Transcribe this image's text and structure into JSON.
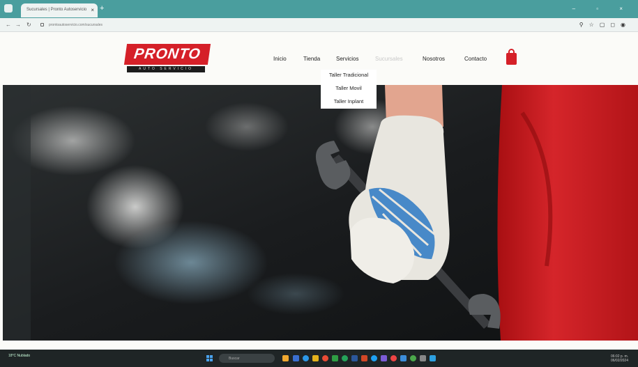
{
  "browser": {
    "tab_title": "Sucursales | Pronto Autoservicio",
    "tab_close": "×",
    "new_tab": "+",
    "url": "prontoautoservicio.com/sucursales",
    "window_controls": "– ▫ ×"
  },
  "site": {
    "logo_main": "PRONTO",
    "logo_sub": "AUTO SERVICIO",
    "nav": [
      "Inicio",
      "Tienda",
      "Servicios",
      "Sucursales",
      "Nosotros",
      "Contacto"
    ],
    "active_nav": "Sucursales",
    "dropdown": [
      "Taller Tradicional",
      "Taller Movil",
      "Taller Inplant"
    ],
    "brand_color": "#d52028"
  },
  "taskbar": {
    "weather": "18°C Nublado",
    "search_placeholder": "Buscar",
    "time": "06:02 p. m.",
    "date": "06/02/2024"
  },
  "icons": [
    "back-icon",
    "forward-icon",
    "reload-icon",
    "site-info-icon",
    "zoom-icon",
    "star-icon",
    "cart-icon",
    "windows-start-icon"
  ]
}
